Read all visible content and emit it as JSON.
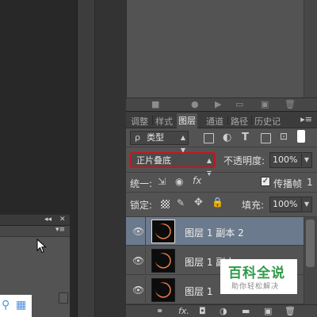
{
  "top_toolbar": {
    "icons": [
      "frame-icon",
      "record-icon",
      "play-icon",
      "folder-icon",
      "new-action-icon",
      "trash-icon"
    ]
  },
  "tabs": [
    {
      "label": "调整",
      "active": false
    },
    {
      "label": "样式",
      "active": false
    },
    {
      "label": "图层",
      "active": true
    },
    {
      "label": "通道",
      "active": false
    },
    {
      "label": "路径",
      "active": false
    },
    {
      "label": "历史记",
      "active": false
    }
  ],
  "tab_menu_label": "▸≡",
  "filter": {
    "kind_label": "类型",
    "search_glyph": "ρ"
  },
  "blend": {
    "mode": "正片叠底"
  },
  "opacity": {
    "label": "不透明度:",
    "value": "100%"
  },
  "unify": {
    "label": "统一:",
    "propagate_label": "传播帧",
    "frame_number": "1"
  },
  "lock": {
    "label": "锁定:"
  },
  "fill": {
    "label": "填充:",
    "value": "100%"
  },
  "layers": [
    {
      "name": "图层 1 副本 2",
      "selected": true
    },
    {
      "name": "图层 1 副本",
      "selected": false
    },
    {
      "name": "图层 1",
      "selected": false
    }
  ],
  "bottom_bar": {
    "fx_label": "fx."
  },
  "float_panel": {
    "collapse_label": "◂◂",
    "close_label": "✕",
    "menu_label": "▾≡"
  },
  "watermark": {
    "title": "百科全说",
    "subtitle": "助你轻松解决"
  }
}
